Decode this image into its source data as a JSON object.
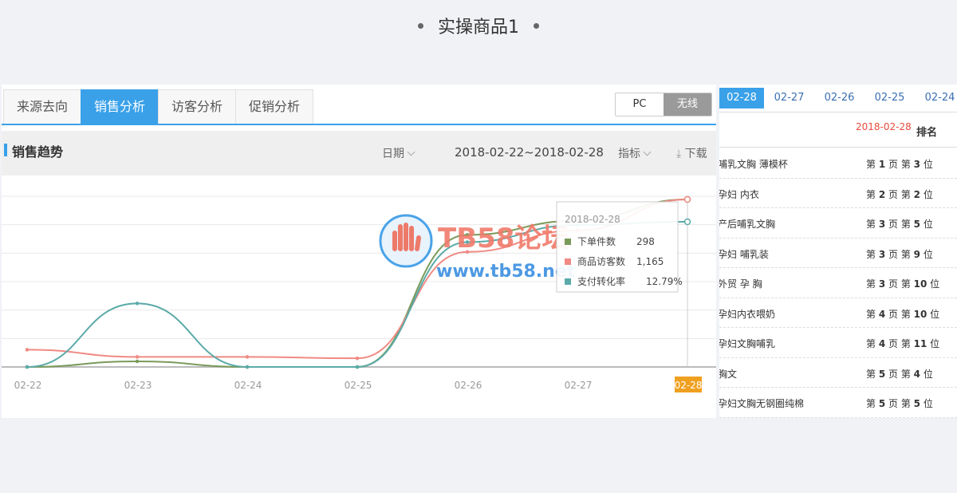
{
  "header": {
    "title": "实操商品1"
  },
  "tabs": [
    "来源去向",
    "销售分析",
    "访客分析",
    "促销分析"
  ],
  "device_switch": {
    "pc": "PC",
    "wireless": "无线"
  },
  "toolbar": {
    "section_title": "销售趋势",
    "date_label": "日期",
    "date_range": "2018-02-22~2018-02-28",
    "metric_label": "指标",
    "download_label": "下载"
  },
  "colors": {
    "accent": "#3aa1e9",
    "orders": "#7a9a5a",
    "visitors": "#f08a84",
    "conversion": "#5aaaa8",
    "highlight": "#f0a020"
  },
  "chart_data": {
    "type": "line",
    "categories": [
      "02-22",
      "02-23",
      "02-24",
      "02-25",
      "02-26",
      "02-27",
      "02-28"
    ],
    "series": [
      {
        "name": "下单件数",
        "values": [
          0,
          10,
          0,
          0,
          235,
          260,
          298
        ]
      },
      {
        "name": "商品访客数",
        "values": [
          120,
          70,
          70,
          60,
          800,
          950,
          1165
        ]
      },
      {
        "name": "支付转化率",
        "values": [
          0,
          5.6,
          0,
          0,
          11.0,
          12.5,
          12.79
        ]
      }
    ],
    "highlight_category": "02-28",
    "tooltip": {
      "date": "2018-02-28",
      "items": [
        {
          "name": "下单件数",
          "value": "298"
        },
        {
          "name": "商品访客数",
          "value": "1,165"
        },
        {
          "name": "支付转化率",
          "value": "12.79%"
        }
      ]
    },
    "grid": true,
    "legend": "none"
  },
  "watermark": {
    "brand": "TB58论坛",
    "url": "www.tb58.net"
  },
  "right_panel": {
    "date_tabs": [
      "02-28",
      "02-27",
      "02-26",
      "02-25",
      "02-24"
    ],
    "header_date": "2018-02-28",
    "header_rank": "排名",
    "rows": [
      {
        "keyword": "哺乳文胸 薄模杯",
        "rank": "第 1 页 第 3 位"
      },
      {
        "keyword": "孕妇 内衣",
        "rank": "第 2 页 第 2 位"
      },
      {
        "keyword": "产后哺乳文胸",
        "rank": "第 3 页 第 5 位"
      },
      {
        "keyword": "孕妇 哺乳装",
        "rank": "第 3 页 第 9 位"
      },
      {
        "keyword": "外贸 孕 胸",
        "rank": "第 3 页 第 10 位"
      },
      {
        "keyword": "孕妇内衣喂奶",
        "rank": "第 4 页 第 10 位"
      },
      {
        "keyword": "孕妇文胸哺乳",
        "rank": "第 4 页 第 11 位"
      },
      {
        "keyword": "胸文",
        "rank": "第 5 页 第 4 位"
      },
      {
        "keyword": "孕妇文胸无钢圈纯棉",
        "rank": "第 5 页 第 5 位"
      }
    ]
  }
}
